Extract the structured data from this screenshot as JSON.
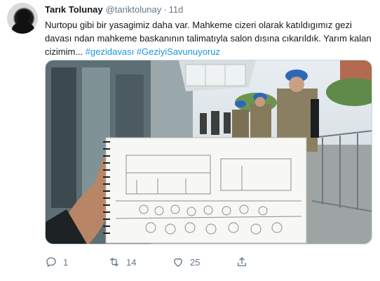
{
  "tweet": {
    "author_name": "Tarık Tolunay",
    "author_handle": "@tariktolunay",
    "separator": "·",
    "time": "11d",
    "text_plain": "Nurtopu gibi bir yasagimiz daha var. Mahkeme cizeri olarak katıldıgımız gezi davası ndan mahkeme baskanının talimatıyla salon dısına cıkarıldık. Yarım kalan cizimim...",
    "hashtags": [
      "#gezidavası",
      "#GeziyiSavunuyoruz"
    ],
    "media_alt": "sketchbook with courtroom drawing held up in front of soldiers in blue berets outside the courthouse"
  },
  "actions": {
    "reply_count": "1",
    "retweet_count": "14",
    "like_count": "25"
  },
  "icons": {
    "reply": "reply-icon",
    "retweet": "retweet-icon",
    "like": "heart-icon",
    "share": "share-icon"
  },
  "colors": {
    "hashtag": "#1b95e0",
    "secondary_text": "#657786",
    "beret": "#2f67b8"
  }
}
